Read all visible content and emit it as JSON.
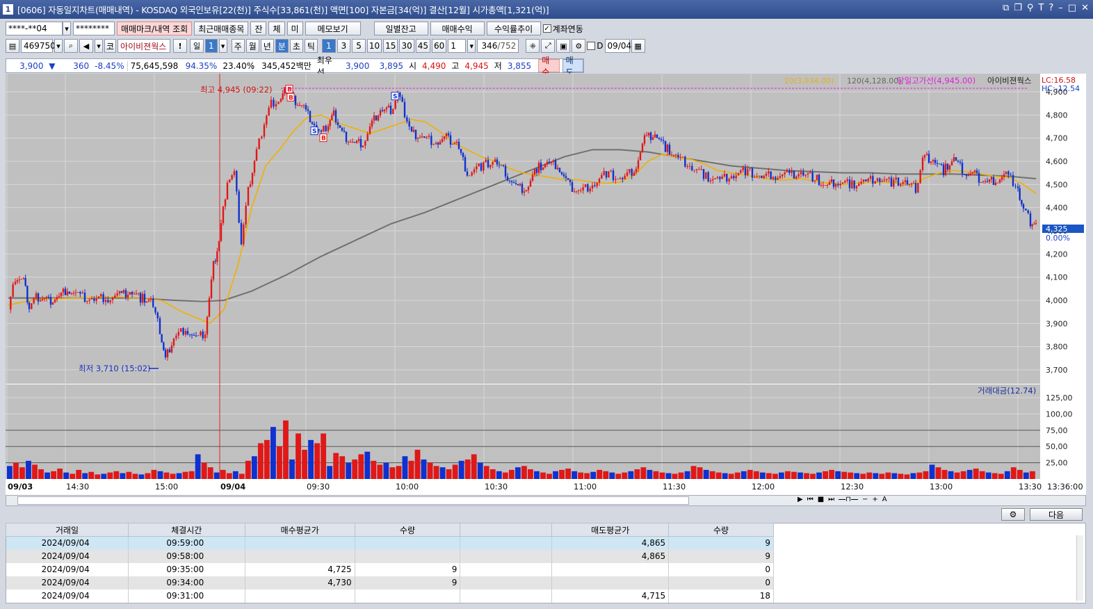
{
  "window": {
    "title": "[0606] 자동일지차트(매매내역) - KOSDAQ 외국인보유[22(천)] 주식수[33,861(천)] 액면[100] 자본금[34(억)] 결산[12월] 시가총액[1,321(억)]",
    "window_number": "1"
  },
  "toolbar1": {
    "account": "****-**04",
    "password": "********",
    "mark_button": "매매마크/내역 조회",
    "recent_button": "최근매매종목",
    "jan": "잔",
    "che": "체",
    "mi": "미",
    "memo": "메모보기",
    "daily_balance": "일별잔고",
    "profit": "매매수익",
    "yield_trend": "수익률추이",
    "account_link": "계좌연동"
  },
  "toolbar2": {
    "code": "469750",
    "market": "코",
    "name": "아이비젼웍스",
    "warn": "!",
    "periods": [
      "일",
      "1"
    ],
    "period_units": [
      "주",
      "월",
      "년",
      "분",
      "초",
      "틱"
    ],
    "minute_buttons": [
      "1",
      "3",
      "5",
      "10",
      "15",
      "30",
      "45",
      "60"
    ],
    "minute_select": "1",
    "count": "346",
    "total": "/752",
    "d_label": "D",
    "date": "09/04"
  },
  "quote": {
    "price": "3,900",
    "change": "360",
    "change_pct": "-8.45%",
    "volume": "75,645,598",
    "vol_ratio": "94.35%",
    "turnover": "23.40%",
    "amount": "345,452백만",
    "best_label": "최우선",
    "ask": "3,900",
    "bid": "3,895",
    "open_label": "시",
    "open": "4,490",
    "high_label": "고",
    "high": "4,945",
    "low_label": "저",
    "low": "3,855",
    "buy_button": "매수",
    "sell_button": "매도"
  },
  "chart_data": {
    "type": "candlestick",
    "stock": "아이비젼웍스",
    "legend": {
      "ma20": "20(3,934.00)",
      "ma120": "120(4,128.00)",
      "high_line": "당일고가선(4,945.00)",
      "name": "아이비젼웍스",
      "lc": "LC:16.58",
      "hc": "HC:-12.54"
    },
    "price_axis": [
      "4,900",
      "4,800",
      "4,700",
      "4,600",
      "4,500",
      "4,400",
      "4,300",
      "4,200",
      "4,100",
      "4,000",
      "3,900",
      "3,800",
      "3,700"
    ],
    "ylim": [
      3640,
      4960
    ],
    "last_price": "4,325",
    "last_pct": "0.00%",
    "high_annotation": "최고 4,945 (09:22)",
    "low_annotation": "최저 3,710 (15:02)",
    "time_labels": [
      "09/03",
      "14:30",
      "15:00",
      "09/04",
      "09:30",
      "10:00",
      "10:30",
      "11:00",
      "11:30",
      "12:00",
      "12:30",
      "13:00",
      "13:30",
      "13:36:00"
    ],
    "volume_title": "거래대금(12.74)",
    "volume_axis": [
      "125,00",
      "100,00",
      "75,00",
      "50,00",
      "25,00"
    ],
    "price_path": [
      [
        0,
        3960
      ],
      [
        10,
        4100
      ],
      [
        22,
        4080
      ],
      [
        30,
        3970
      ],
      [
        40,
        4010
      ],
      [
        55,
        3995
      ],
      [
        70,
        4010
      ],
      [
        85,
        4050
      ],
      [
        100,
        4020
      ],
      [
        120,
        4000
      ],
      [
        140,
        4010
      ],
      [
        160,
        4020
      ],
      [
        175,
        4040
      ],
      [
        190,
        4010
      ],
      [
        205,
        4000
      ],
      [
        218,
        3870
      ],
      [
        226,
        3750
      ],
      [
        238,
        3840
      ],
      [
        255,
        3880
      ],
      [
        270,
        3830
      ],
      [
        283,
        3860
      ],
      [
        295,
        4150
      ],
      [
        303,
        4260
      ],
      [
        315,
        4520
      ],
      [
        325,
        4550
      ],
      [
        335,
        4250
      ],
      [
        345,
        4470
      ],
      [
        357,
        4640
      ],
      [
        368,
        4770
      ],
      [
        378,
        4850
      ],
      [
        392,
        4860
      ],
      [
        400,
        4920
      ],
      [
        410,
        4870
      ],
      [
        425,
        4830
      ],
      [
        440,
        4760
      ],
      [
        450,
        4720
      ],
      [
        460,
        4760
      ],
      [
        468,
        4800
      ],
      [
        480,
        4720
      ],
      [
        495,
        4680
      ],
      [
        510,
        4680
      ],
      [
        520,
        4750
      ],
      [
        535,
        4820
      ],
      [
        550,
        4820
      ],
      [
        560,
        4900
      ],
      [
        570,
        4810
      ],
      [
        580,
        4720
      ],
      [
        595,
        4700
      ],
      [
        615,
        4680
      ],
      [
        630,
        4700
      ],
      [
        645,
        4680
      ],
      [
        660,
        4550
      ],
      [
        680,
        4580
      ],
      [
        700,
        4600
      ],
      [
        715,
        4550
      ],
      [
        730,
        4490
      ],
      [
        745,
        4480
      ],
      [
        760,
        4570
      ],
      [
        775,
        4590
      ],
      [
        790,
        4580
      ],
      [
        805,
        4500
      ],
      [
        820,
        4470
      ],
      [
        840,
        4500
      ],
      [
        860,
        4550
      ],
      [
        880,
        4520
      ],
      [
        900,
        4560
      ],
      [
        915,
        4700
      ],
      [
        930,
        4720
      ],
      [
        945,
        4660
      ],
      [
        960,
        4620
      ],
      [
        980,
        4580
      ],
      [
        1000,
        4540
      ],
      [
        1020,
        4520
      ],
      [
        1040,
        4540
      ],
      [
        1060,
        4560
      ],
      [
        1080,
        4530
      ],
      [
        1100,
        4540
      ],
      [
        1120,
        4540
      ],
      [
        1140,
        4550
      ],
      [
        1160,
        4530
      ],
      [
        1175,
        4490
      ],
      [
        1190,
        4510
      ],
      [
        1210,
        4500
      ],
      [
        1230,
        4510
      ],
      [
        1250,
        4530
      ],
      [
        1270,
        4510
      ],
      [
        1290,
        4510
      ],
      [
        1305,
        4480
      ],
      [
        1315,
        4620
      ],
      [
        1330,
        4610
      ],
      [
        1345,
        4560
      ],
      [
        1360,
        4610
      ],
      [
        1375,
        4550
      ],
      [
        1390,
        4540
      ],
      [
        1405,
        4510
      ],
      [
        1420,
        4520
      ],
      [
        1435,
        4540
      ],
      [
        1445,
        4510
      ],
      [
        1452,
        4480
      ],
      [
        1460,
        4400
      ],
      [
        1470,
        4340
      ],
      [
        1478,
        4325
      ]
    ],
    "ma20_path": [
      [
        0,
        3980
      ],
      [
        40,
        4005
      ],
      [
        100,
        4010
      ],
      [
        160,
        4015
      ],
      [
        220,
        4000
      ],
      [
        250,
        3950
      ],
      [
        290,
        3900
      ],
      [
        310,
        3960
      ],
      [
        330,
        4150
      ],
      [
        350,
        4400
      ],
      [
        370,
        4580
      ],
      [
        390,
        4650
      ],
      [
        410,
        4730
      ],
      [
        430,
        4790
      ],
      [
        450,
        4800
      ],
      [
        470,
        4770
      ],
      [
        500,
        4740
      ],
      [
        520,
        4720
      ],
      [
        540,
        4740
      ],
      [
        560,
        4760
      ],
      [
        580,
        4780
      ],
      [
        600,
        4770
      ],
      [
        620,
        4730
      ],
      [
        640,
        4680
      ],
      [
        660,
        4650
      ],
      [
        680,
        4620
      ],
      [
        700,
        4600
      ],
      [
        720,
        4570
      ],
      [
        740,
        4550
      ],
      [
        760,
        4540
      ],
      [
        780,
        4530
      ],
      [
        800,
        4520
      ],
      [
        820,
        4520
      ],
      [
        840,
        4510
      ],
      [
        860,
        4505
      ],
      [
        880,
        4510
      ],
      [
        900,
        4540
      ],
      [
        920,
        4600
      ],
      [
        940,
        4630
      ],
      [
        960,
        4620
      ],
      [
        980,
        4610
      ],
      [
        1000,
        4590
      ],
      [
        1020,
        4560
      ],
      [
        1040,
        4550
      ],
      [
        1060,
        4540
      ],
      [
        1080,
        4530
      ],
      [
        1100,
        4520
      ],
      [
        1120,
        4520
      ],
      [
        1140,
        4525
      ],
      [
        1160,
        4515
      ],
      [
        1180,
        4505
      ],
      [
        1200,
        4500
      ],
      [
        1220,
        4505
      ],
      [
        1240,
        4510
      ],
      [
        1260,
        4510
      ],
      [
        1280,
        4505
      ],
      [
        1300,
        4500
      ],
      [
        1320,
        4530
      ],
      [
        1340,
        4550
      ],
      [
        1360,
        4560
      ],
      [
        1380,
        4555
      ],
      [
        1400,
        4545
      ],
      [
        1420,
        4535
      ],
      [
        1440,
        4530
      ],
      [
        1460,
        4500
      ],
      [
        1478,
        4460
      ]
    ],
    "ma120_path": [
      [
        0,
        4010
      ],
      [
        60,
        4010
      ],
      [
        120,
        4010
      ],
      [
        180,
        4010
      ],
      [
        240,
        4000
      ],
      [
        280,
        3995
      ],
      [
        310,
        4000
      ],
      [
        350,
        4040
      ],
      [
        400,
        4110
      ],
      [
        450,
        4190
      ],
      [
        500,
        4260
      ],
      [
        550,
        4330
      ],
      [
        600,
        4380
      ],
      [
        650,
        4440
      ],
      [
        700,
        4500
      ],
      [
        750,
        4560
      ],
      [
        800,
        4620
      ],
      [
        840,
        4650
      ],
      [
        880,
        4650
      ],
      [
        920,
        4640
      ],
      [
        960,
        4620
      ],
      [
        1000,
        4600
      ],
      [
        1040,
        4580
      ],
      [
        1080,
        4570
      ],
      [
        1120,
        4560
      ],
      [
        1160,
        4555
      ],
      [
        1200,
        4550
      ],
      [
        1240,
        4550
      ],
      [
        1280,
        4545
      ],
      [
        1320,
        4545
      ],
      [
        1360,
        4545
      ],
      [
        1400,
        4540
      ],
      [
        1440,
        4535
      ],
      [
        1478,
        4525
      ]
    ],
    "volume_bars": [
      20,
      25,
      18,
      28,
      22,
      15,
      10,
      12,
      16,
      10,
      8,
      14,
      9,
      11,
      7,
      8,
      10,
      12,
      9,
      11,
      8,
      7,
      9,
      14,
      12,
      10,
      8,
      9,
      11,
      12,
      38,
      25,
      18,
      10,
      14,
      9,
      12,
      8,
      28,
      35,
      55,
      60,
      80,
      50,
      90,
      30,
      70,
      45,
      60,
      55,
      70,
      20,
      40,
      35,
      25,
      30,
      38,
      42,
      28,
      22,
      25,
      18,
      20,
      35,
      28,
      45,
      30,
      25,
      20,
      18,
      15,
      22,
      28,
      30,
      38,
      25,
      20,
      15,
      12,
      10,
      14,
      18,
      20,
      15,
      12,
      10,
      8,
      12,
      14,
      16,
      12,
      10,
      9,
      11,
      14,
      12,
      10,
      8,
      10,
      12,
      15,
      18,
      14,
      12,
      10,
      9,
      8,
      10,
      12,
      20,
      18,
      14,
      12,
      10,
      9,
      8,
      10,
      12,
      14,
      12,
      10,
      9,
      8,
      10,
      12,
      11,
      10,
      9,
      8,
      10,
      12,
      14,
      12,
      11,
      10,
      9,
      8,
      10,
      9,
      8,
      10,
      9,
      8,
      7,
      9,
      10,
      12,
      22,
      18,
      14,
      12,
      10,
      12,
      14,
      16,
      12,
      10,
      9,
      8,
      12,
      18,
      14,
      10,
      12
    ]
  },
  "scrollbar": {
    "next_button": "다음"
  },
  "table": {
    "headers": [
      "거래일",
      "체결시간",
      "매수평균가",
      "수량",
      "",
      "매도평균가",
      "수량"
    ],
    "rows": [
      [
        "2024/09/04",
        "09:59:00",
        "",
        "",
        "",
        "4,865",
        "9"
      ],
      [
        "2024/09/04",
        "09:58:00",
        "",
        "",
        "",
        "4,865",
        "9"
      ],
      [
        "2024/09/04",
        "09:35:00",
        "4,725",
        "9",
        "",
        "",
        "0"
      ],
      [
        "2024/09/04",
        "09:34:00",
        "4,730",
        "9",
        "",
        "",
        "0"
      ],
      [
        "2024/09/04",
        "09:31:00",
        "",
        "",
        "",
        "4,715",
        "18"
      ]
    ]
  }
}
